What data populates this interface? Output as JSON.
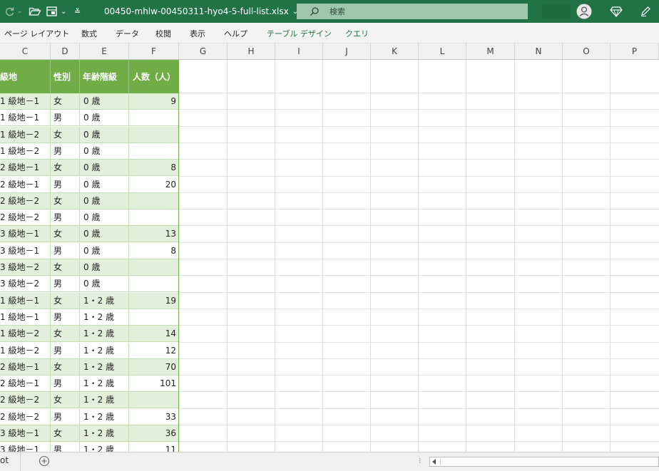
{
  "titlebar": {
    "filename": "00450-mhlw-00450311-hyo4-5-full-list.xlsx",
    "search_placeholder": "検索",
    "bg_color": "#217346"
  },
  "ribbon": {
    "tabs": [
      "ページ レイアウト",
      "数式",
      "データ",
      "校閲",
      "表示",
      "ヘルプ",
      "テーブル デザイン",
      "クエリ"
    ]
  },
  "columns": [
    "C",
    "D",
    "E",
    "F",
    "G",
    "H",
    "I",
    "J",
    "K",
    "L",
    "M",
    "N",
    "O",
    "P"
  ],
  "table": {
    "headers": [
      "級地",
      "性別",
      "年齢階級",
      "人数（人）"
    ],
    "header_color": "#70ad47",
    "band_color": "#e2efda",
    "rows": [
      {
        "grade": "1 級地－1",
        "sex": "女",
        "age": "0 歳",
        "count": "9"
      },
      {
        "grade": "1 級地－1",
        "sex": "男",
        "age": "0 歳",
        "count": ""
      },
      {
        "grade": "1 級地－2",
        "sex": "女",
        "age": "0 歳",
        "count": ""
      },
      {
        "grade": "1 級地－2",
        "sex": "男",
        "age": "0 歳",
        "count": ""
      },
      {
        "grade": "2 級地－1",
        "sex": "女",
        "age": "0 歳",
        "count": "8"
      },
      {
        "grade": "2 級地－1",
        "sex": "男",
        "age": "0 歳",
        "count": "20"
      },
      {
        "grade": "2 級地－2",
        "sex": "女",
        "age": "0 歳",
        "count": ""
      },
      {
        "grade": "2 級地－2",
        "sex": "男",
        "age": "0 歳",
        "count": ""
      },
      {
        "grade": "3 級地－1",
        "sex": "女",
        "age": "0 歳",
        "count": "13"
      },
      {
        "grade": "3 級地－1",
        "sex": "男",
        "age": "0 歳",
        "count": "8"
      },
      {
        "grade": "3 級地－2",
        "sex": "女",
        "age": "0 歳",
        "count": ""
      },
      {
        "grade": "3 級地－2",
        "sex": "男",
        "age": "0 歳",
        "count": ""
      },
      {
        "grade": "1 級地－1",
        "sex": "女",
        "age": "1・2 歳",
        "count": "19"
      },
      {
        "grade": "1 級地－1",
        "sex": "男",
        "age": "1・2 歳",
        "count": ""
      },
      {
        "grade": "1 級地－2",
        "sex": "女",
        "age": "1・2 歳",
        "count": "14"
      },
      {
        "grade": "1 級地－2",
        "sex": "男",
        "age": "1・2 歳",
        "count": "12"
      },
      {
        "grade": "2 級地－1",
        "sex": "女",
        "age": "1・2 歳",
        "count": "70"
      },
      {
        "grade": "2 級地－1",
        "sex": "男",
        "age": "1・2 歳",
        "count": "101"
      },
      {
        "grade": "2 級地－2",
        "sex": "女",
        "age": "1・2 歳",
        "count": ""
      },
      {
        "grade": "2 級地－2",
        "sex": "男",
        "age": "1・2 歳",
        "count": "33"
      },
      {
        "grade": "3 級地－1",
        "sex": "女",
        "age": "1・2 歳",
        "count": "36"
      },
      {
        "grade": "3 級地－1",
        "sex": "男",
        "age": "1・2 歳",
        "count": "11"
      }
    ]
  },
  "status": {
    "sheet_tab": "ot",
    "add_sheet_icon": "plus-circle-icon"
  }
}
